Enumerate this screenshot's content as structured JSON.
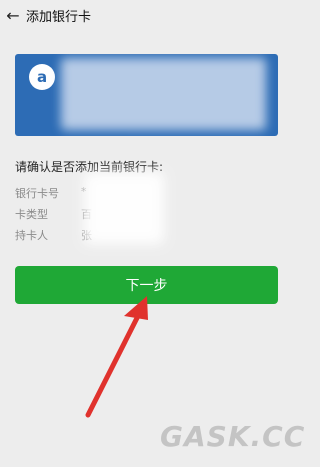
{
  "header": {
    "back_symbol": "←",
    "title": "添加银行卡"
  },
  "card": {
    "logo_icon": "bank-logo-icon",
    "logo_glyph": "a",
    "background_color": "#2d6cb5"
  },
  "confirm": {
    "title": "请确认是否添加当前银行卡:",
    "fields": [
      {
        "label": "银行卡号",
        "value": "*"
      },
      {
        "label": "卡类型",
        "value": "百"
      },
      {
        "label": "持卡人",
        "value": "张"
      }
    ]
  },
  "next_button": {
    "label": "下一步",
    "color": "#1fa836"
  },
  "watermark": "GASK.CC",
  "arrow_color": "#e0322d"
}
